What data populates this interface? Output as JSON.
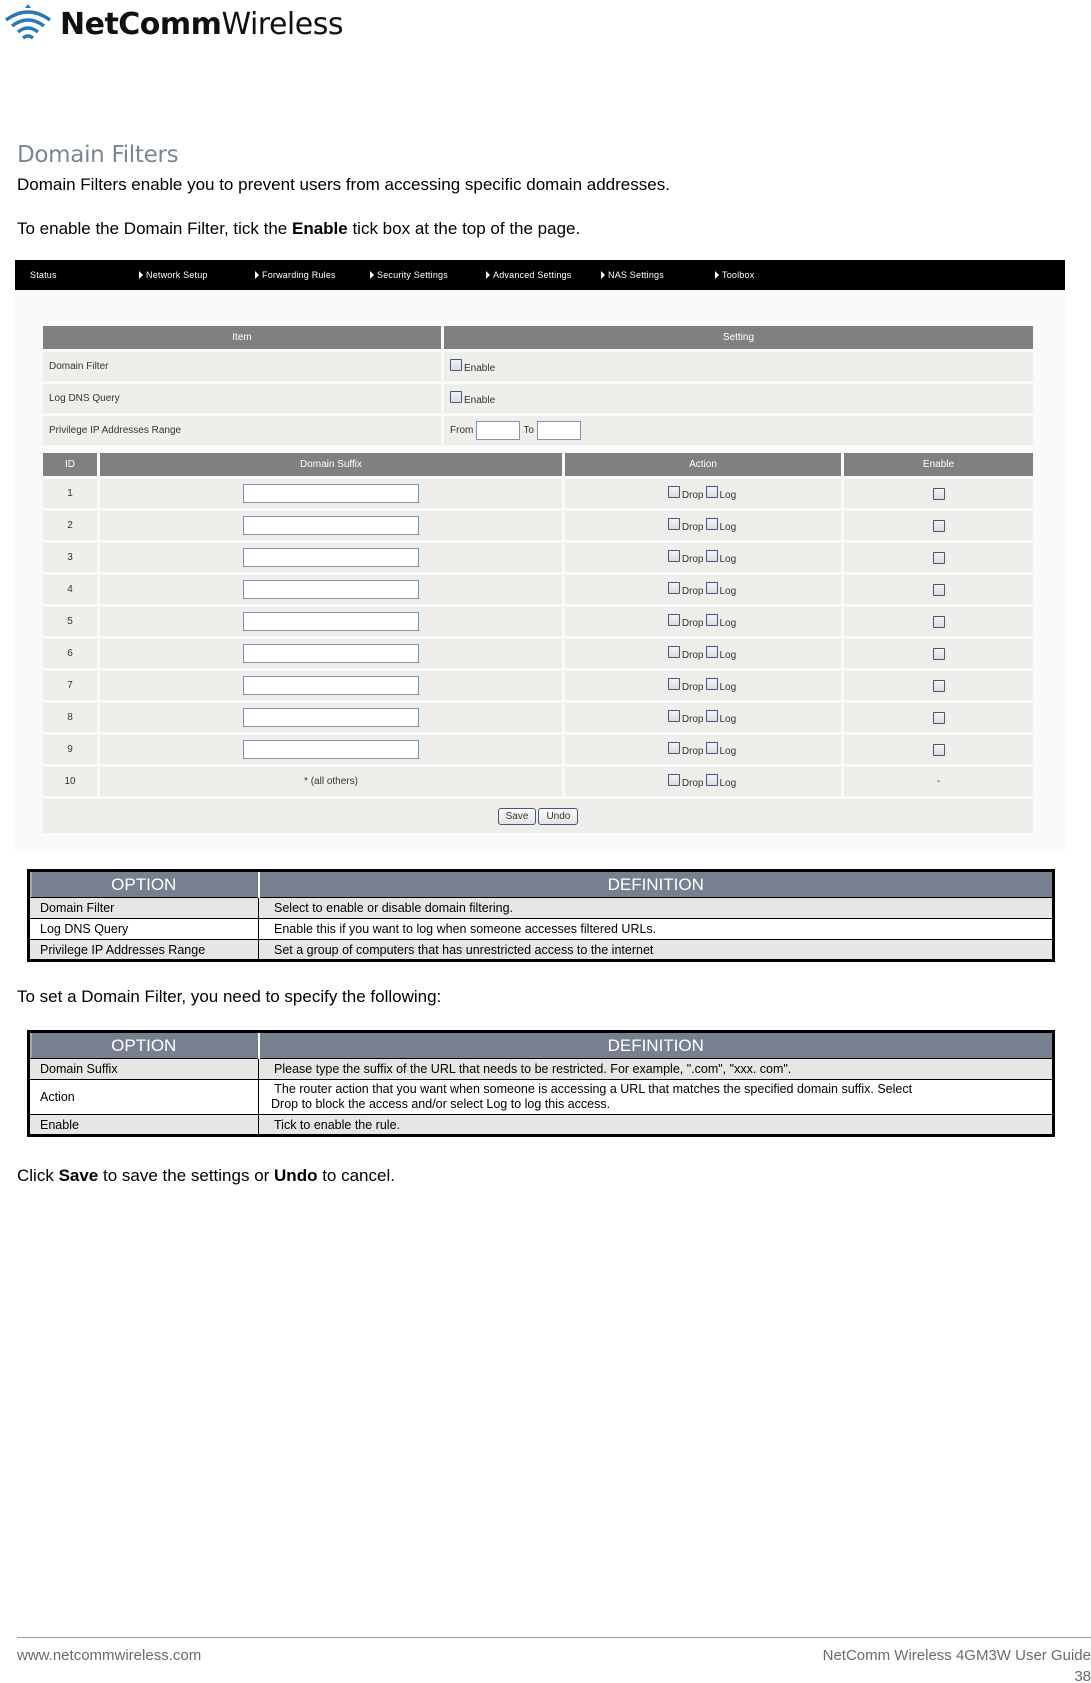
{
  "brand": {
    "logo_bold": "NetComm",
    "logo_light": "Wireless"
  },
  "section": {
    "title": "Domain Filters",
    "intro": "Domain Filters enable you to prevent users from accessing specific domain addresses.",
    "enable_prefix": "To enable the Domain Filter, tick the ",
    "enable_bold": "Enable",
    "enable_suffix": " tick box at the top of the page."
  },
  "router_ui": {
    "nav": [
      {
        "label": "Status",
        "arrow": false
      },
      {
        "label": "Network Setup",
        "arrow": true
      },
      {
        "label": "Forwarding Rules",
        "arrow": true
      },
      {
        "label": "Security Settings",
        "arrow": true
      },
      {
        "label": "Advanced Settings",
        "arrow": true
      },
      {
        "label": "NAS Settings",
        "arrow": true
      },
      {
        "label": "Toolbox",
        "arrow": true
      }
    ],
    "settings_header": {
      "item": "Item",
      "setting": "Setting"
    },
    "settings_rows": {
      "domain_filter": {
        "label": "Domain Filter",
        "checkbox_label": "Enable",
        "checked": false
      },
      "log_dns": {
        "label": "Log DNS Query",
        "checkbox_label": "Enable",
        "checked": false
      },
      "privilege": {
        "label": "Privilege IP Addresses Range",
        "from_label": "From",
        "to_label": "To",
        "from_value": "",
        "to_value": ""
      }
    },
    "rules_header": {
      "id": "ID",
      "suffix": "Domain Suffix",
      "action": "Action",
      "enable": "Enable"
    },
    "action_labels": {
      "drop": "Drop",
      "log": "Log"
    },
    "rules": [
      {
        "id": "1",
        "suffix": ""
      },
      {
        "id": "2",
        "suffix": ""
      },
      {
        "id": "3",
        "suffix": ""
      },
      {
        "id": "4",
        "suffix": ""
      },
      {
        "id": "5",
        "suffix": ""
      },
      {
        "id": "6",
        "suffix": ""
      },
      {
        "id": "7",
        "suffix": ""
      },
      {
        "id": "8",
        "suffix": ""
      },
      {
        "id": "9",
        "suffix": ""
      }
    ],
    "last_rule": {
      "id": "10",
      "suffix_text": "* (all others)",
      "enable_text": "-"
    },
    "buttons": {
      "save": "Save",
      "undo": "Undo"
    }
  },
  "table1": {
    "headers": {
      "option": "OPTION",
      "definition": "DEFINITION"
    },
    "rows": [
      {
        "option": "Domain Filter",
        "definition": "Select to enable or disable domain filtering."
      },
      {
        "option": "Log DNS Query",
        "definition": "Enable this if you want to log when someone accesses filtered URLs."
      },
      {
        "option": "Privilege IP Addresses Range",
        "definition": "Set a group of computers that has unrestricted access to the internet"
      }
    ]
  },
  "set_filter_text": "To set a Domain Filter, you need to specify the following:",
  "table2": {
    "headers": {
      "option": "OPTION",
      "definition": "DEFINITION"
    },
    "rows": [
      {
        "option": "Domain Suffix",
        "definition": "Please type the suffix of the URL that needs to be restricted. For example, \".com\", \"xxx. com\"."
      },
      {
        "option": "Action",
        "definition_line1": " The router action that you want when someone is accessing a URL that matches the specified domain suffix. Select",
        "definition_line2": "Drop to block the access and/or select Log to log this access."
      },
      {
        "option": "Enable",
        "definition": "Tick to enable the rule."
      }
    ]
  },
  "closing": {
    "prefix": "Click ",
    "save": "Save",
    "middle": " to save the settings or ",
    "undo": "Undo",
    "suffix": " to cancel."
  },
  "footer": {
    "website": "www.netcommwireless.com",
    "guide": "NetComm Wireless 4GM3W User Guide",
    "page": "38"
  }
}
